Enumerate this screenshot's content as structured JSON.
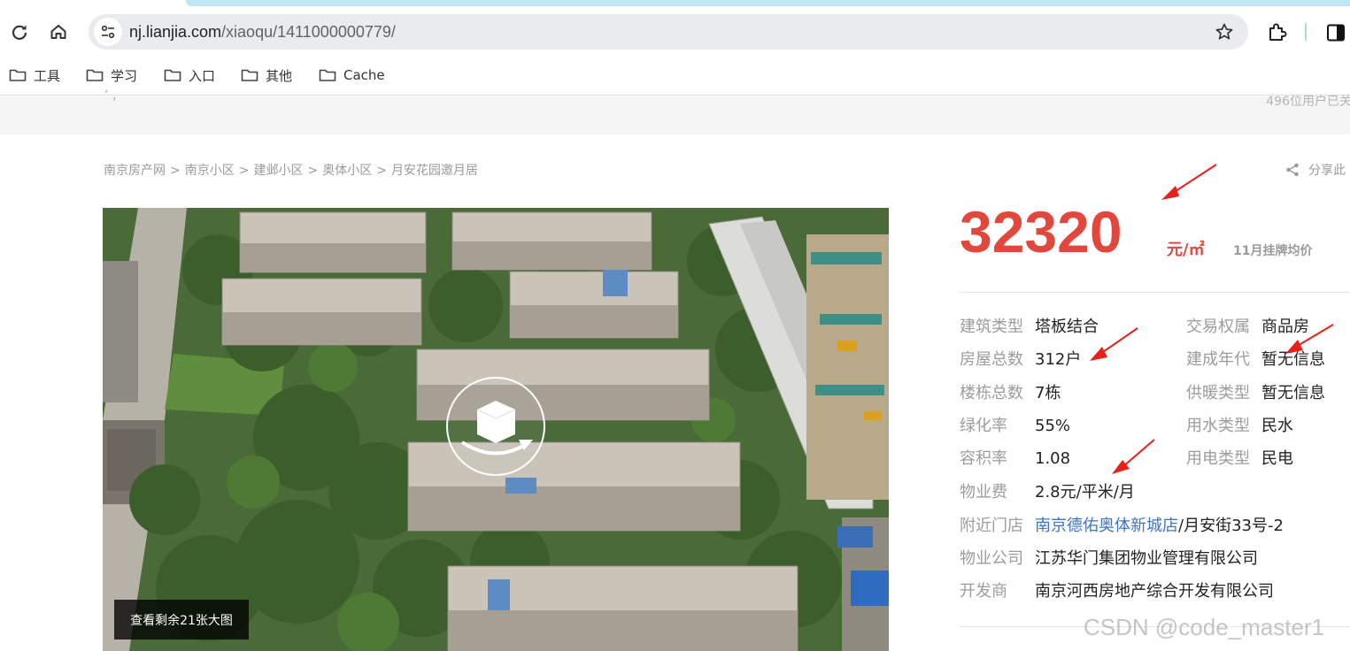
{
  "browser": {
    "url_host": "nj.lianjia.com",
    "url_path": "/xiaoqu/1411000000779/",
    "bookmarks": [
      "工具",
      "学习",
      "入口",
      "其他",
      "Cache"
    ]
  },
  "header_band": {
    "stub_text": "‘  ‚",
    "buyers_text": "496位用户已关"
  },
  "breadcrumb": [
    "南京房产网",
    "南京小区",
    "建邺小区",
    "奥体小区",
    "月安花园邀月居"
  ],
  "breadcrumb_separator": ">",
  "share_label": "分享此",
  "photo": {
    "more_photos_label": "查看剩余21张大图"
  },
  "price": {
    "value": "32320",
    "unit": "元/㎡",
    "note": "11月挂牌均价"
  },
  "info_left": [
    {
      "label": "建筑类型",
      "value": "塔板结合"
    },
    {
      "label": "房屋总数",
      "value": "312户"
    },
    {
      "label": "楼栋总数",
      "value": "7栋"
    },
    {
      "label": "绿化率",
      "value": "55%"
    },
    {
      "label": "容积率",
      "value": "1.08"
    },
    {
      "label": "物业费",
      "value": "2.8元/平米/月"
    }
  ],
  "info_right": [
    {
      "label": "交易权属",
      "value": "商品房"
    },
    {
      "label": "建成年代",
      "value": "暂无信息"
    },
    {
      "label": "供暖类型",
      "value": "暂无信息"
    },
    {
      "label": "用水类型",
      "value": "民水"
    },
    {
      "label": "用电类型",
      "value": "民电"
    }
  ],
  "info_full": [
    {
      "label": "附近门店",
      "link": "南京德佑奥体新城店",
      "value": "/月安街33号-2"
    },
    {
      "label": "物业公司",
      "value": "江苏华门集团物业管理有限公司"
    },
    {
      "label": "开发商",
      "value": "南京河西房地产综合开发有限公司"
    }
  ],
  "watermark": "CSDN @code_master1",
  "colors": {
    "price_red": "#e1473d",
    "link_blue": "#3e74c9",
    "label_gray": "#9c9c9c",
    "arrow_red": "#e8201a"
  }
}
